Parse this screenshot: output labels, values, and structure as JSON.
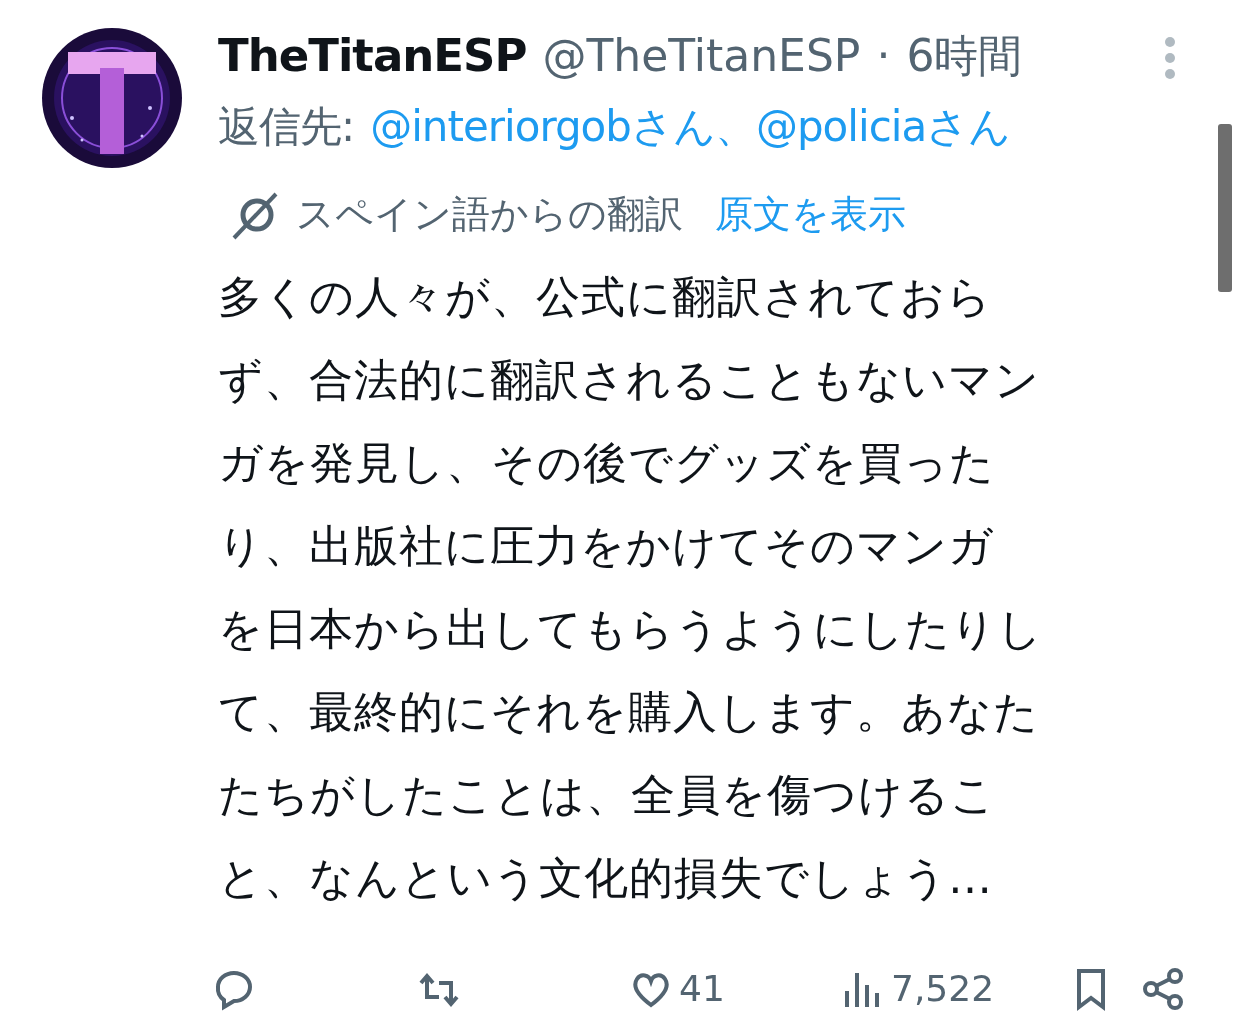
{
  "author": {
    "name": "TheTitanESP",
    "handle": "@TheTitanESP",
    "separator": "·",
    "time": "6時間"
  },
  "reply_to": {
    "label": "返信先:",
    "mentions": [
      "@interiorgobさん",
      "@policiaさん"
    ],
    "joiner": "、"
  },
  "translation": {
    "label": "スペイン語からの翻訳",
    "link": "原文を表示"
  },
  "body_lines": [
    "多くの人々が、公式に翻訳されておら",
    "ず、合法的に翻訳されることもないマン",
    "ガを発見し、その後でグッズを買った",
    "り、出版社に圧力をかけてそのマンガ",
    "を日本から出してもらうようにしたりし",
    "て、最終的にそれを購入します。あなた",
    "たちがしたことは、全員を傷つけるこ",
    "と、なんという文化的損失でしょう…"
  ],
  "actions": [
    {
      "kind": "reply"
    },
    {
      "kind": "repost"
    },
    {
      "kind": "like",
      "count": "41"
    },
    {
      "kind": "views",
      "count": "7,522"
    },
    {
      "kind": "bookmark"
    },
    {
      "kind": "share"
    }
  ]
}
